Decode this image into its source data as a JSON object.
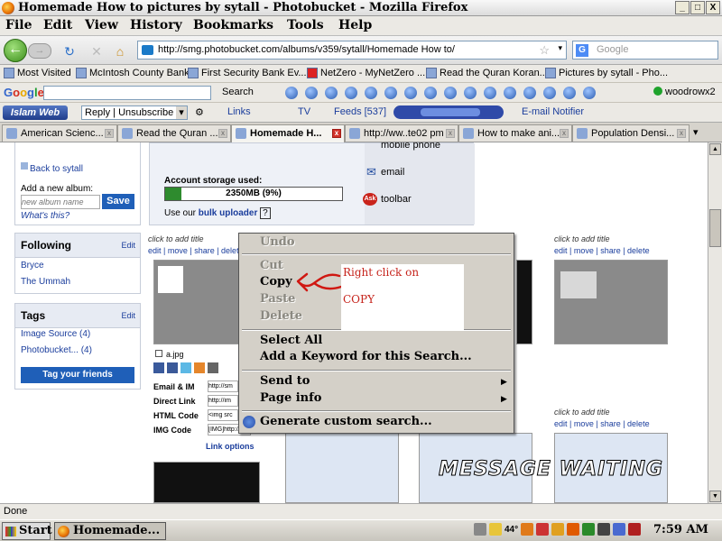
{
  "window": {
    "title": "Homemade How to pictures by sytall - Photobucket - Mozilla Firefox",
    "minimize": "_",
    "maximize": "□",
    "close": "X"
  },
  "menu": [
    "File",
    "Edit",
    "View",
    "History",
    "Bookmarks",
    "Tools",
    "Help"
  ],
  "nav": {
    "url": "http://smg.photobucket.com/albums/v359/sytall/Homemade How to/",
    "search_placeholder": "Google",
    "search_engine_icon": "G"
  },
  "bookmarks": [
    "Most Visited",
    "McIntosh County Bank",
    "First Security Bank Ev...",
    "NetZero - MyNetZero ...",
    "Read the Quran Koran...",
    "Pictures by sytall - Pho..."
  ],
  "google_toolbar": {
    "logo": [
      "G",
      "o",
      "o",
      "g",
      "l",
      "e"
    ],
    "search_label": "Search",
    "user": "woodrowx2"
  },
  "islam_toolbar": {
    "logo": "Islam Web 2.0",
    "reply_select": "Reply | Unsubscribe",
    "links": "Links",
    "tv": "TV",
    "feeds": "Feeds [537]",
    "email_notifier": "E-mail Notifier"
  },
  "tabs": [
    {
      "label": "American Scienc...",
      "active": false
    },
    {
      "label": "Read the Quran ...",
      "active": false
    },
    {
      "label": "Homemade H...",
      "active": true
    },
    {
      "label": "http://ww..te02 pm",
      "active": false
    },
    {
      "label": "How to make ani...",
      "active": false
    },
    {
      "label": "Population Densi...",
      "active": false
    }
  ],
  "sidebar": {
    "back_link": "Back to sytall",
    "add_album_label": "Add a new album:",
    "album_placeholder": "new album name",
    "save": "Save",
    "whats_this": "What's this?",
    "following": {
      "title": "Following",
      "edit": "Edit",
      "items": [
        "Bryce",
        "The Ummah"
      ]
    },
    "tags": {
      "title": "Tags",
      "edit": "Edit",
      "items": [
        "Image Source (4)",
        "Photobucket... (4)"
      ],
      "tag_button": "Tag your friends"
    }
  },
  "storage": {
    "label": "Account storage used:",
    "bar_text": "2350MB (9%)",
    "percent": 9,
    "uploader_prefix": "Use our",
    "uploader_link": "bulk uploader",
    "help": "?",
    "options": [
      "mobile phone",
      "email",
      "toolbar"
    ]
  },
  "photos": {
    "caption": "click to add title",
    "actions": "edit | move | share | delete",
    "filename": "a.jpg",
    "link_rows": [
      {
        "label": "Email & IM",
        "value": "http://sm"
      },
      {
        "label": "Direct Link",
        "value": "http://im"
      },
      {
        "label": "HTML Code",
        "value": "<img src"
      },
      {
        "label": "IMG Code",
        "value": "[IMG]http://im"
      }
    ],
    "link_options": "Link options"
  },
  "context_menu": {
    "undo": "Undo",
    "cut": "Cut",
    "copy": "Copy",
    "paste": "Paste",
    "delete": "Delete",
    "select_all": "Select All",
    "add_keyword": "Add a Keyword for this Search...",
    "send_to": "Send to",
    "page_info": "Page info",
    "custom_search": "Generate custom search..."
  },
  "annotation": {
    "line1": "Right click on",
    "line2": "COPY",
    "color": "#c6241c"
  },
  "watermark": "MESSAGE WAITING",
  "status": "Done",
  "taskbar": {
    "start": "Start",
    "task": "Homemade...",
    "temp": "44°",
    "clock": "7:59 AM"
  }
}
